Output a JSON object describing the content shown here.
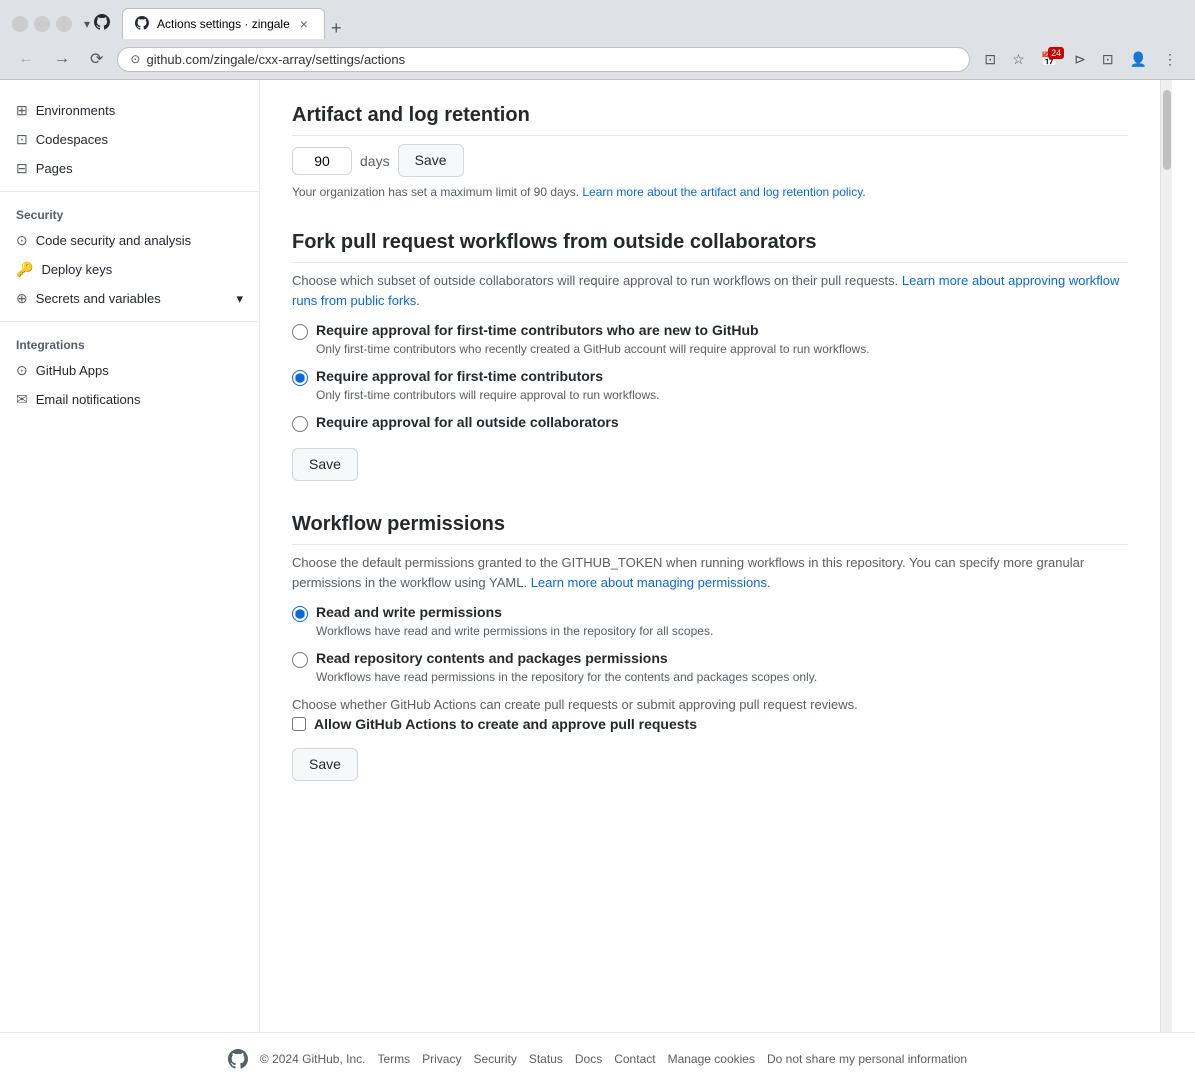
{
  "browser": {
    "tab_title": "Actions settings · zingale",
    "url": "github.com/zingale/cxx-array/settings/actions",
    "new_tab_label": "+"
  },
  "sidebar": {
    "section_security": "Security",
    "section_integrations": "Integrations",
    "items": [
      {
        "id": "environments",
        "label": "Environments",
        "icon": "⊞"
      },
      {
        "id": "codespaces",
        "label": "Codespaces",
        "icon": "⊡"
      },
      {
        "id": "pages",
        "label": "Pages",
        "icon": "⊟"
      },
      {
        "id": "code-security",
        "label": "Code security and analysis",
        "icon": "⊙"
      },
      {
        "id": "deploy-keys",
        "label": "Deploy keys",
        "icon": "🔑"
      },
      {
        "id": "secrets-variables",
        "label": "Secrets and variables",
        "icon": "⊕",
        "hasArrow": true
      },
      {
        "id": "github-apps",
        "label": "GitHub Apps",
        "icon": "⊙"
      },
      {
        "id": "email-notifications",
        "label": "Email notifications",
        "icon": "✉"
      }
    ]
  },
  "main": {
    "artifact_section": {
      "title": "Artifact and log retention",
      "days_value": "90",
      "days_label": "days",
      "save_label": "Save",
      "note": "Your organization has set a maximum limit of 90 days.",
      "note_link": "Learn more about the artifact and log retention policy."
    },
    "fork_section": {
      "title": "Fork pull request workflows from outside collaborators",
      "desc": "Choose which subset of outside collaborators will require approval to run workflows on their pull requests.",
      "desc_link_text": "Learn more about approving workflow runs from public forks.",
      "options": [
        {
          "id": "opt1",
          "label": "Require approval for first-time contributors who are new to GitHub",
          "desc": "Only first-time contributors who recently created a GitHub account will require approval to run workflows.",
          "checked": false
        },
        {
          "id": "opt2",
          "label": "Require approval for first-time contributors",
          "desc": "Only first-time contributors will require approval to run workflows.",
          "checked": true
        },
        {
          "id": "opt3",
          "label": "Require approval for all outside collaborators",
          "desc": "",
          "checked": false
        }
      ],
      "save_label": "Save"
    },
    "workflow_section": {
      "title": "Workflow permissions",
      "desc": "Choose the default permissions granted to the GITHUB_TOKEN when running workflows in this repository. You can specify more granular permissions in the workflow using YAML.",
      "desc_link_text": "Learn more about managing permissions.",
      "options": [
        {
          "id": "wp1",
          "label": "Read and write permissions",
          "desc": "Workflows have read and write permissions in the repository for all scopes.",
          "checked": true
        },
        {
          "id": "wp2",
          "label": "Read repository contents and packages permissions",
          "desc": "Workflows have read permissions in the repository for the contents and packages scopes only.",
          "checked": false
        }
      ],
      "checkbox_label": "Allow GitHub Actions to create and approve pull requests",
      "checkbox_desc": "Choose whether GitHub Actions can create pull requests or submit approving pull request reviews.",
      "save_label": "Save"
    }
  },
  "footer": {
    "copyright": "© 2024 GitHub, Inc.",
    "links": [
      "Terms",
      "Privacy",
      "Security",
      "Status",
      "Docs",
      "Contact",
      "Manage cookies",
      "Do not share my personal information"
    ]
  }
}
